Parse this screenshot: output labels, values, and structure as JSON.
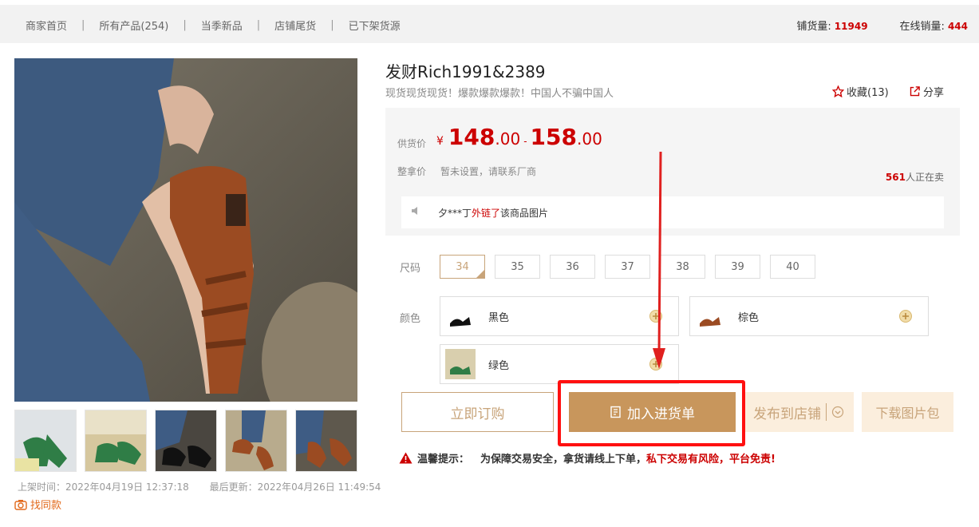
{
  "nav": {
    "items": [
      "商家首页",
      "所有产品(254)",
      "当季新品",
      "店铺尾货",
      "已下架货源"
    ],
    "separator": "|",
    "stats": [
      {
        "label": "铺货量:",
        "value": "11949"
      },
      {
        "label": "在线销量:",
        "value": "444"
      }
    ]
  },
  "gallery": {
    "listed_time": "上架时间：2022年04月19日 12:37:18",
    "updated_time": "最后更新：2022年04月26日 11:49:54",
    "find_same": "找同款"
  },
  "product": {
    "title": "发财Rich1991&2389",
    "subtitle": "现货现货现货！爆款爆款爆款！中国人不骗中国人",
    "favorite": "收藏(13)",
    "share": "分享",
    "price_label": "供货价",
    "currency": "¥",
    "price_low_int": "148",
    "price_low_dec": ".00",
    "price_dash": "-",
    "price_high_int": "158",
    "price_high_dec": ".00",
    "wholesale_label": "整拿价",
    "wholesale_value": "暂未设置，请联系厂商",
    "selling_count": "561",
    "selling_text": "人正在卖",
    "notice_user": "夕***丁",
    "notice_action": "外链了",
    "notice_rest": "该商品图片",
    "size_label": "尺码",
    "sizes": [
      "34",
      "35",
      "36",
      "37",
      "38",
      "39",
      "40"
    ],
    "selected_size": "34",
    "color_label": "颜色",
    "colors": [
      "黑色",
      "棕色",
      "绿色"
    ]
  },
  "actions": {
    "order": "立即订购",
    "add_to_cart": "加入进货单",
    "publish": "发布到店铺",
    "download": "下载图片包"
  },
  "warning": {
    "label": "温馨提示：",
    "text": "为保障交易安全，拿货请线上下单，",
    "red": "私下交易有风险，平台免责!"
  },
  "colors": {
    "accent": "#c8965c",
    "price_red": "#cc0000",
    "highlight_box": "#ff1010",
    "arrow": "#e0201f"
  }
}
